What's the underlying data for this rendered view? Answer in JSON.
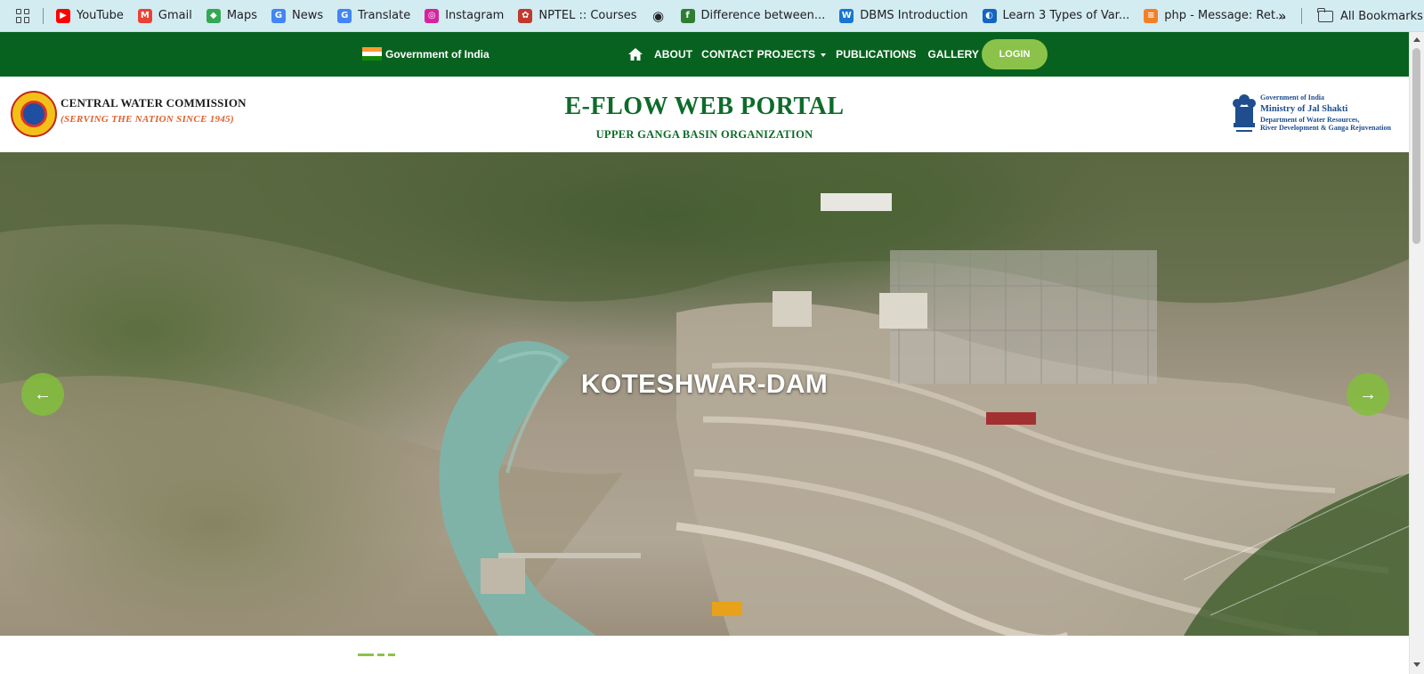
{
  "bookmarks": {
    "items": [
      {
        "label": "YouTube",
        "icon": "youtube-icon",
        "color": "#ff0000"
      },
      {
        "label": "Gmail",
        "icon": "gmail-icon",
        "color": "#ea4335"
      },
      {
        "label": "Maps",
        "icon": "maps-icon",
        "color": "#34a853"
      },
      {
        "label": "News",
        "icon": "news-icon",
        "color": "#4285f4"
      },
      {
        "label": "Translate",
        "icon": "translate-icon",
        "color": "#4285f4"
      },
      {
        "label": "Instagram",
        "icon": "instagram-icon",
        "color": "#d6249f"
      },
      {
        "label": "NPTEL :: Courses",
        "icon": "nptel-icon",
        "color": "#c0392b"
      },
      {
        "label": "",
        "icon": "globe-icon",
        "color": "#202124"
      },
      {
        "label": "Difference between...",
        "icon": "difference-site-icon",
        "color": "#2e7d32"
      },
      {
        "label": "DBMS Introduction",
        "icon": "dbms-site-icon",
        "color": "#1976d2"
      },
      {
        "label": "Learn 3 Types of Var...",
        "icon": "learn-site-icon",
        "color": "#1565c0"
      },
      {
        "label": "php - Message: Ret...",
        "icon": "stackoverflow-icon",
        "color": "#f48024"
      }
    ],
    "more_label": "»",
    "all_bookmarks_label": "All Bookmarks"
  },
  "topnav": {
    "government_label": "Government of India",
    "links": [
      "ABOUT",
      "CONTACT",
      "PROJECTS",
      "PUBLICATIONS",
      "GALLERY"
    ],
    "login_label": "LOGIN",
    "background_color": "#08621f",
    "login_color": "#8bc34a"
  },
  "header": {
    "org_title": "CENTRAL WATER COMMISSION",
    "org_tagline": "(SERVING THE NATION SINCE 1945)",
    "portal_title": "E-FLOW WEB PORTAL",
    "portal_subtitle": "UPPER GANGA BASIN ORGANIZATION",
    "ministry": {
      "line1": "Government of India",
      "line2": "Ministry of Jal Shakti",
      "line3": "Department of Water Resources,",
      "line4": "River Development & Ganga Rejuvenation"
    },
    "title_color": "#0e6b2a"
  },
  "hero": {
    "caption": "KOTESHWAR-DAM",
    "prev_arrow": "←",
    "next_arrow": "→"
  }
}
